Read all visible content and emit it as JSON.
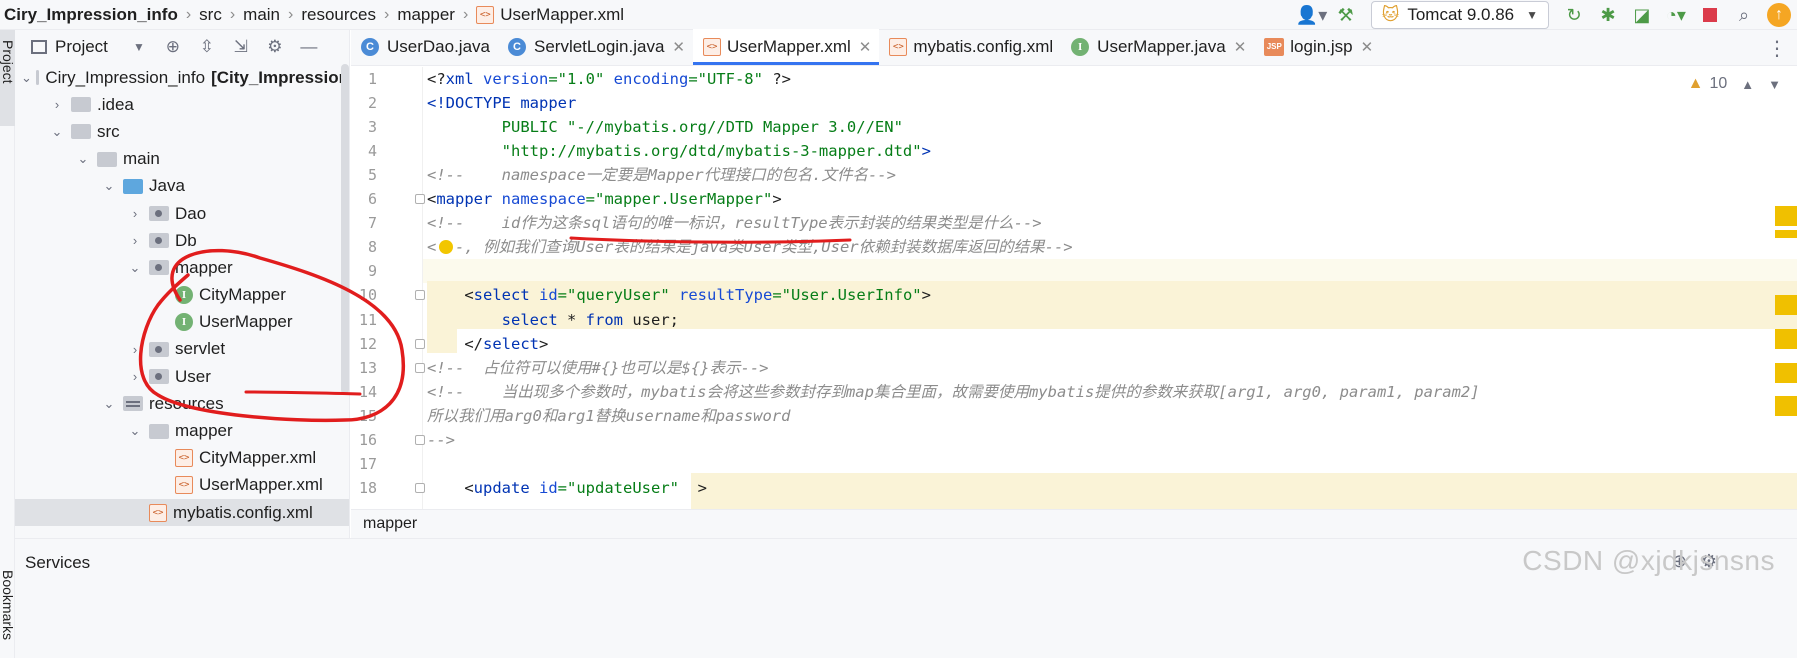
{
  "breadcrumb": [
    "Ciry_Impression_info",
    "src",
    "main",
    "resources",
    "mapper",
    "UserMapper.xml"
  ],
  "run_config": {
    "label": "Tomcat 9.0.86"
  },
  "project_panel": {
    "title": "Project",
    "tree": [
      {
        "label": "Ciry_Impression_info",
        "suffix": "[City_Impression",
        "level": 0,
        "icon": "module-folder-icon",
        "expanded": true
      },
      {
        "label": ".idea",
        "level": 1,
        "icon": "folder-icon",
        "expanded": false
      },
      {
        "label": "src",
        "level": 1,
        "icon": "folder-icon",
        "expanded": true
      },
      {
        "label": "main",
        "level": 2,
        "icon": "folder-icon",
        "expanded": true
      },
      {
        "label": "Java",
        "level": 3,
        "icon": "source-folder-icon",
        "expanded": true
      },
      {
        "label": "Dao",
        "level": 4,
        "icon": "package-icon",
        "expanded": false
      },
      {
        "label": "Db",
        "level": 4,
        "icon": "package-icon",
        "expanded": false
      },
      {
        "label": "mapper",
        "level": 4,
        "icon": "package-icon",
        "expanded": true
      },
      {
        "label": "CityMapper",
        "level": 5,
        "icon": "interface-icon"
      },
      {
        "label": "UserMapper",
        "level": 5,
        "icon": "interface-icon"
      },
      {
        "label": "servlet",
        "level": 4,
        "icon": "package-icon",
        "expanded": false
      },
      {
        "label": "User",
        "level": 4,
        "icon": "package-icon",
        "expanded": false
      },
      {
        "label": "resources",
        "level": 3,
        "icon": "resources-folder-icon",
        "expanded": true
      },
      {
        "label": "mapper",
        "level": 4,
        "icon": "folder-icon",
        "expanded": true
      },
      {
        "label": "CityMapper.xml",
        "level": 5,
        "icon": "xml-file-icon"
      },
      {
        "label": "UserMapper.xml",
        "level": 5,
        "icon": "xml-file-icon"
      },
      {
        "label": "mybatis.config.xml",
        "level": 4,
        "icon": "xml-file-icon",
        "selected": true
      }
    ]
  },
  "tabs": [
    {
      "label": "UserDao.java",
      "icon": "class-icon",
      "icon_letter": "C",
      "active": false,
      "closable": false
    },
    {
      "label": "ServletLogin.java",
      "icon": "class-icon",
      "icon_letter": "C",
      "active": false,
      "closable": true
    },
    {
      "label": "UserMapper.xml",
      "icon": "xml-file-icon",
      "icon_letter": "<>",
      "active": true,
      "closable": true
    },
    {
      "label": "mybatis.config.xml",
      "icon": "xml-file-icon",
      "icon_letter": "<>",
      "active": false,
      "closable": false
    },
    {
      "label": "UserMapper.java",
      "icon": "interface-icon",
      "icon_letter": "I",
      "active": false,
      "closable": true
    },
    {
      "label": "login.jsp",
      "icon": "jsp-file-icon",
      "icon_letter": "JSP",
      "active": false,
      "closable": true
    }
  ],
  "editor": {
    "warnings_count": "10",
    "line_numbers": [
      "1",
      "2",
      "3",
      "4",
      "5",
      "6",
      "7",
      "8",
      "9",
      "10",
      "11",
      "12",
      "13",
      "14",
      "15",
      "16",
      "17",
      "18"
    ],
    "lines": [
      [
        {
          "c": "t",
          "v": "<?"
        },
        {
          "c": "k",
          "v": "xml "
        },
        {
          "c": "a",
          "v": "version"
        },
        {
          "c": "s",
          "v": "=\"1.0\" "
        },
        {
          "c": "a",
          "v": "encoding"
        },
        {
          "c": "s",
          "v": "=\"UTF-8\" "
        },
        {
          "c": "t",
          "v": "?>"
        }
      ],
      [
        {
          "c": "k",
          "v": "<!DOCTYPE mapper"
        }
      ],
      [
        {
          "c": "s",
          "v": "        PUBLIC \"-//mybatis.org//DTD Mapper 3.0//EN\""
        }
      ],
      [
        {
          "c": "s",
          "v": "        \"http://mybatis.org/dtd/mybatis-3-mapper.dtd\""
        },
        {
          "c": "k",
          "v": ">"
        }
      ],
      [
        {
          "c": "c",
          "v": "<!--    namespace一定要是Mapper代理接口的包名.文件名-->"
        }
      ],
      [
        {
          "c": "t",
          "v": "<"
        },
        {
          "c": "k",
          "v": "mapper "
        },
        {
          "c": "a",
          "v": "namespace"
        },
        {
          "c": "s",
          "v": "=\"mapper.UserMapper\""
        },
        {
          "c": "t",
          "v": ">"
        }
      ],
      [
        {
          "c": "c",
          "v": "<!--    id作为这条sql语句的唯一标识，resultType表示封装的结果类型是什么-->"
        }
      ],
      [
        {
          "c": "c",
          "v": "<  -, 例如我们查询User表的结果是java类User类型,User依赖封装数据库返回的结果-->"
        }
      ],
      [],
      [
        {
          "c": "t",
          "v": "    <"
        },
        {
          "c": "k",
          "v": "select "
        },
        {
          "c": "a",
          "v": "id"
        },
        {
          "c": "s",
          "v": "=\"queryUser\" "
        },
        {
          "c": "a",
          "v": "resultType"
        },
        {
          "c": "s",
          "v": "=\"User.UserInfo\""
        },
        {
          "c": "t",
          "v": ">"
        }
      ],
      [
        {
          "c": "t",
          "v": "        "
        },
        {
          "c": "k",
          "v": "select "
        },
        {
          "c": "t",
          "v": "* "
        },
        {
          "c": "k",
          "v": "from "
        },
        {
          "c": "t",
          "v": "user;"
        }
      ],
      [
        {
          "c": "t",
          "v": "    </"
        },
        {
          "c": "k",
          "v": "select"
        },
        {
          "c": "t",
          "v": ">"
        }
      ],
      [
        {
          "c": "c",
          "v": "<!--  占位符可以使用#{}也可以是${}表示-->"
        }
      ],
      [
        {
          "c": "c",
          "v": "<!--    当出现多个参数时，mybatis会将这些参数封存到map集合里面，故需要使用mybatis提供的参数来获取[arg1, arg0, param1, param2]"
        }
      ],
      [
        {
          "c": "c",
          "v": "所以我们用arg0和arg1替换username和password"
        }
      ],
      [
        {
          "c": "c",
          "v": "-->"
        }
      ],
      [],
      [
        {
          "c": "t",
          "v": "    <"
        },
        {
          "c": "k",
          "v": "update "
        },
        {
          "c": "a",
          "v": "id"
        },
        {
          "c": "s",
          "v": "=\"updateUser\"  "
        },
        {
          "c": "t",
          "v": ">"
        }
      ]
    ]
  },
  "editor_breadcrumb": "mapper",
  "services": {
    "label": "Services"
  },
  "left_strip": {
    "project_label": "Project",
    "bottom_label": "Bookmarks"
  },
  "watermark": "CSDN @xjdkjsnsns"
}
